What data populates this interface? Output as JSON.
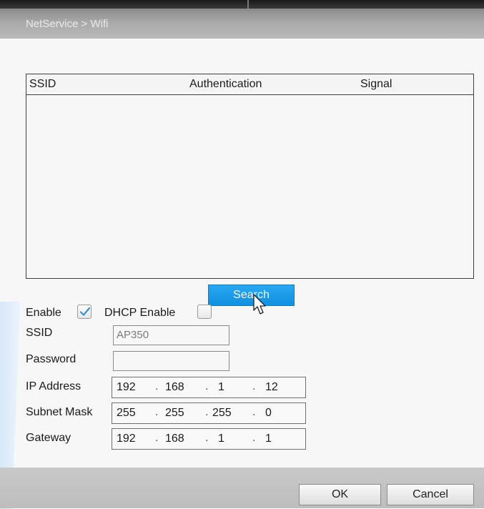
{
  "window": {
    "title": "NetService > Wifi"
  },
  "list": {
    "columns": [
      "SSID",
      "Authentication",
      "Signal"
    ],
    "rows": []
  },
  "search": {
    "label": "Search"
  },
  "options": {
    "enable_label": "Enable",
    "enable_checked": true,
    "dhcp_label": "DHCP Enable",
    "dhcp_checked": false
  },
  "fields": {
    "ssid": {
      "label": "SSID",
      "value": "AP350"
    },
    "password": {
      "label": "Password",
      "value": ""
    },
    "ip_address": {
      "label": "IP Address",
      "octets": [
        "192",
        "168",
        "1",
        "12"
      ]
    },
    "subnet_mask": {
      "label": "Subnet Mask",
      "octets": [
        "255",
        "255",
        "255",
        "0"
      ]
    },
    "gateway": {
      "label": "Gateway",
      "octets": [
        "192",
        "168",
        "1",
        "1"
      ]
    }
  },
  "buttons": {
    "ok": "OK",
    "cancel": "Cancel"
  },
  "colors": {
    "accent": "#1a9ae8",
    "checkmark": "#3a8fd6",
    "title_bar": "#a0a0a0"
  }
}
